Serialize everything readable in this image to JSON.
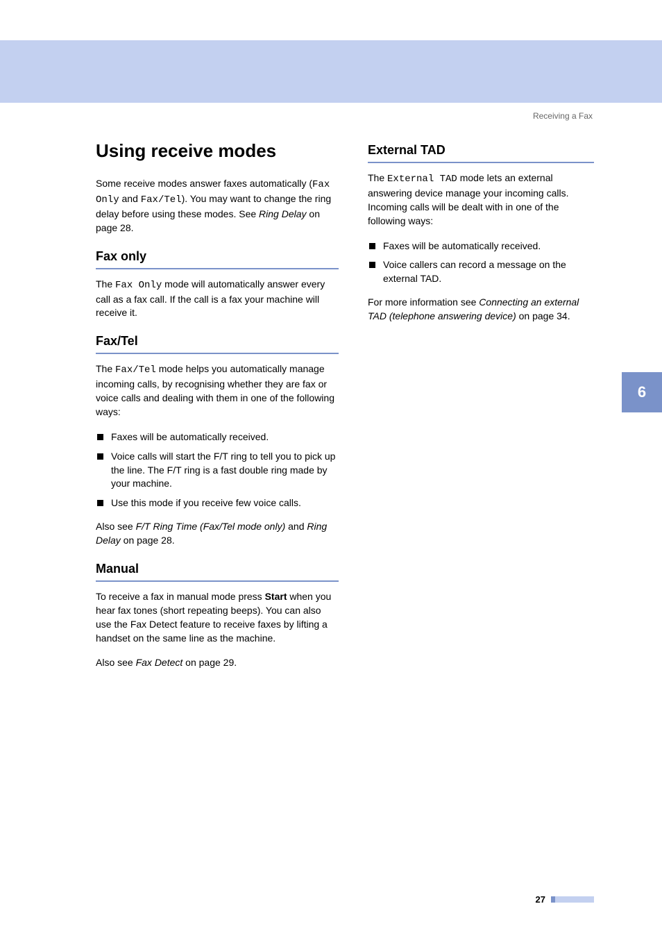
{
  "breadcrumb": "Receiving a Fax",
  "chapter_number": "6",
  "page_number": "27",
  "left": {
    "main_heading": "Using receive modes",
    "intro_part1": "Some receive modes answer faxes automatically (",
    "intro_code1": "Fax Only",
    "intro_mid1": " and ",
    "intro_code2": "Fax/Tel",
    "intro_part2": "). You may want to change the ring delay before using these modes. See ",
    "intro_italic": "Ring Delay",
    "intro_tail": " on page 28.",
    "fax_only": {
      "heading": "Fax only",
      "p1a": "The ",
      "p1code": "Fax Only",
      "p1b": " mode will automatically answer every call as a fax call. If the call is a fax your machine will receive it."
    },
    "fax_tel": {
      "heading": "Fax/Tel",
      "p1a": "The ",
      "p1code": "Fax/Tel",
      "p1b": " mode helps you automatically manage incoming calls, by recognising whether they are fax or voice calls and dealing with them in one of the following ways:",
      "b1": "Faxes will be automatically received.",
      "b2": "Voice calls will start the F/T ring to tell you to pick up the line. The F/T ring is a fast double ring made by your machine.",
      "b3": "Use this mode if you receive few voice calls.",
      "also_a": "Also see ",
      "also_i1": "F/T Ring Time (Fax/Tel mode only)",
      "also_mid": " and ",
      "also_i2": "Ring Delay",
      "also_tail": " on page 28."
    },
    "manual": {
      "heading": "Manual",
      "p1a": "To receive a fax in manual mode press ",
      "p1bold": "Start",
      "p1b": " when you hear fax tones (short repeating beeps). You can also use the Fax Detect feature to receive faxes by lifting a handset on the same line as the machine.",
      "also_a": "Also see ",
      "also_i": "Fax Detect",
      "also_tail": " on page 29."
    }
  },
  "right": {
    "ext_tad": {
      "heading": "External TAD",
      "p1a": "The ",
      "p1code": "External TAD",
      "p1b": " mode lets an external answering device manage your incoming calls. Incoming calls will be dealt with in one of the following ways:",
      "b1": "Faxes will be automatically received.",
      "b2": "Voice callers can record a message on the external TAD.",
      "p2a": "For more information see ",
      "p2i": "Connecting an external TAD (telephone answering device)",
      "p2tail": " on page 34."
    }
  }
}
